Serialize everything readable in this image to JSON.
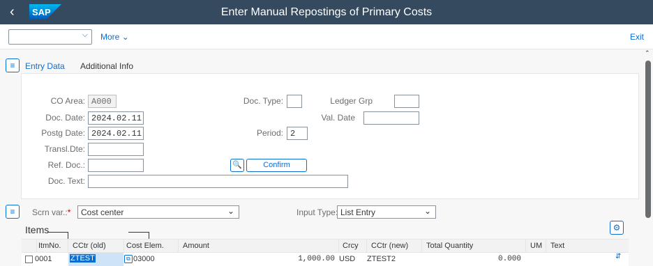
{
  "header": {
    "title": "Enter Manual Repostings of Primary Costs",
    "logo_text": "SAP"
  },
  "toolbar": {
    "select_value": "",
    "more_label": "More",
    "exit_label": "Exit"
  },
  "tabs": [
    {
      "label": "Entry Data",
      "active": true
    },
    {
      "label": "Additional Info",
      "active": false
    }
  ],
  "form": {
    "co_area": {
      "label": "CO Area:",
      "value": "A000"
    },
    "doc_date": {
      "label": "Doc. Date:",
      "value": "2024.02.11"
    },
    "postg_date": {
      "label": "Postg Date:",
      "value": "2024.02.11"
    },
    "transl_dte": {
      "label": "Transl.Dte:",
      "value": ""
    },
    "ref_doc": {
      "label": "Ref. Doc.:",
      "value": ""
    },
    "doc_text": {
      "label": "Doc. Text:",
      "value": ""
    },
    "doc_type": {
      "label": "Doc. Type:",
      "value": ""
    },
    "ledger_grp": {
      "label": "Ledger Grp",
      "value": ""
    },
    "val_date": {
      "label": "Val. Date",
      "value": ""
    },
    "period": {
      "label": "Period:",
      "value": "2"
    },
    "confirm_label": "Confirm"
  },
  "screen_variant": {
    "label": "Scrn var.:",
    "value": "Cost center"
  },
  "input_type": {
    "label": "Input Type:",
    "value": "List Entry"
  },
  "items": {
    "title": "Items",
    "columns": [
      "ItmNo.",
      "CCtr (old)",
      "Cost Elem.",
      "Amount",
      "Crcy",
      "CCtr (new)",
      "Total Quantity",
      "UM",
      "Text"
    ],
    "rows": [
      {
        "itm_no": "0001",
        "cctr_old": "ZTEST",
        "cost_elem": "03000",
        "amount": "1,000.00",
        "crcy": "USD",
        "cctr_new": "ZTEST2",
        "total_quantity": "0.000",
        "um": "",
        "text": ""
      }
    ]
  },
  "colors": {
    "shell": "#354a5f",
    "accent": "#0a6ed1",
    "required": "#bb0000",
    "selection": "#cfe3f8"
  }
}
